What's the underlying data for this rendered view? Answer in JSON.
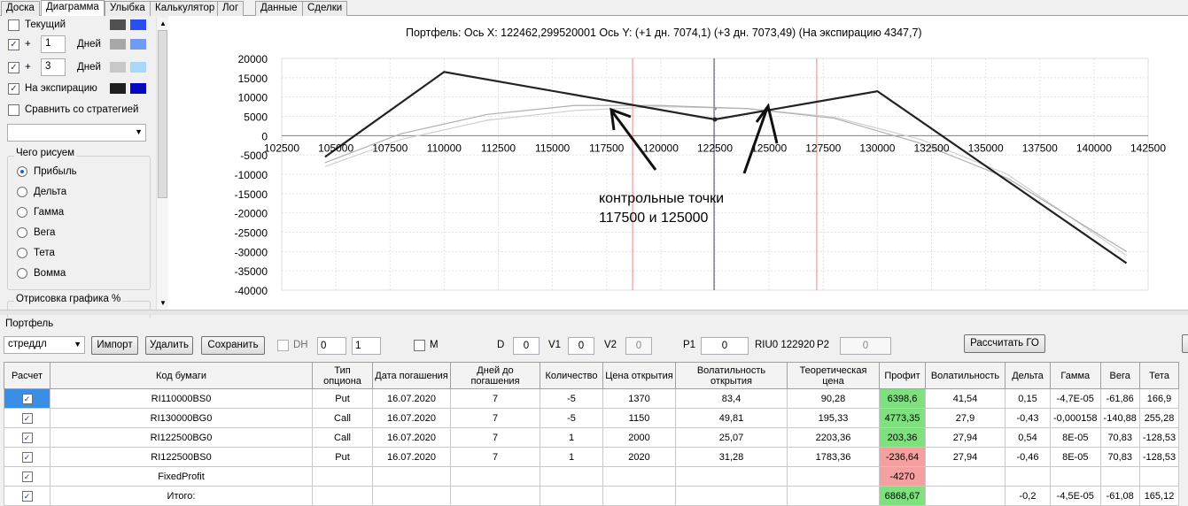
{
  "tabs": [
    "Доска",
    "Диаграмма",
    "Улыбка",
    "Калькулятор",
    "Лог",
    "Данные",
    "Сделки"
  ],
  "left": {
    "current_label": "Текущий",
    "plus1": "+",
    "days1_value": "1",
    "days_label1": "Дней",
    "plus2": "+",
    "days2_value": "3",
    "days_label2": "Дней",
    "expiration_label": "На экспирацию",
    "compare_label": "Сравнить со стратегией",
    "what_group": "Чего рисуем",
    "radios": [
      "Прибыль",
      "Дельта",
      "Гамма",
      "Вега",
      "Тета",
      "Вомма"
    ],
    "drawing_group": "Отрисовка графика %"
  },
  "chart_title": "Портфель: Ось X:  122462,299520001 Ось Y:   (+1 дн. 7074,1)   (+3 дн. 7073,49)   (На экспирацию 4347,7)",
  "annotation_line1": "контрольные точки",
  "annotation_line2": "117500 и 125000",
  "chart_data": {
    "type": "line",
    "xlim": [
      102500,
      142500
    ],
    "ylim": [
      -40000,
      20000
    ],
    "x_ticks": [
      "102500",
      "105000",
      "107500",
      "110000",
      "112500",
      "115000",
      "117500",
      "120000",
      "122500",
      "125000",
      "127500",
      "130000",
      "132500",
      "135000",
      "137500",
      "140000",
      "142500"
    ],
    "y_ticks": [
      "20000",
      "15000",
      "10000",
      "5000",
      "0",
      "-5000",
      "-10000",
      "-15000",
      "-20000",
      "-25000",
      "-30000",
      "-35000",
      "-40000"
    ],
    "series": [
      {
        "x": [
          104500,
          110000,
          122500,
          130000,
          141500
        ],
        "y": [
          -5500,
          16500,
          4200,
          11500,
          -33000
        ]
      },
      {
        "x": [
          104500,
          108000,
          112000,
          116000,
          120000,
          124000,
          128000,
          132000,
          136000,
          141500
        ],
        "y": [
          -7000,
          500,
          5500,
          7800,
          7800,
          7000,
          4500,
          -2000,
          -11000,
          -30000
        ]
      },
      {
        "x": [
          104500,
          108000,
          112000,
          116000,
          120000,
          124000,
          128000,
          132000,
          136000,
          141500
        ],
        "y": [
          -8000,
          -1000,
          4000,
          6500,
          7500,
          7000,
          4800,
          -1000,
          -10000,
          -31000
        ]
      }
    ],
    "vlines": [
      {
        "x": 118700,
        "color": "#f2a0a0"
      },
      {
        "x": 122462,
        "color": "#6a6a90"
      },
      {
        "x": 127200,
        "color": "#f2a0a0"
      }
    ],
    "grid": true
  },
  "portfolio": {
    "title": "Портфель",
    "strategy": "стреддл",
    "import": "Импорт",
    "delete": "Удалить",
    "save": "Сохранить",
    "dh": "DH",
    "num1": "0",
    "num2": "1",
    "m": "M",
    "d_label": "D",
    "d_value": "0",
    "v1_label": "V1",
    "v1_value": "0",
    "v2_label": "V2",
    "v2_value": "0",
    "p1_label": "P1",
    "p1_value": "0",
    "riu": "RIU0 122920",
    "p2_label": "P2",
    "p2_value": "0",
    "calc": "Рассчитать ГО"
  },
  "table": {
    "headers": [
      "Расчет",
      "Код бумаги",
      "Тип опциона",
      "Дата погашения",
      "Дней до погашения",
      "Количество",
      "Цена открытия",
      "Волатильность открытия",
      "Теоретическая цена",
      "Профит",
      "Волатильность",
      "Дельта",
      "Гамма",
      "Вега",
      "Тета"
    ],
    "rows": [
      [
        "RI110000BS0",
        "Put",
        "16.07.2020",
        "7",
        "-5",
        "1370",
        "83,4",
        "90,28",
        "6398,6",
        "41,54",
        "0,15",
        "-4,7E-05",
        "-61,86",
        "166,9"
      ],
      [
        "RI130000BG0",
        "Call",
        "16.07.2020",
        "7",
        "-5",
        "1150",
        "49,81",
        "195,33",
        "4773,35",
        "27,9",
        "-0,43",
        "-0,000158",
        "-140,88",
        "255,28"
      ],
      [
        "RI122500BG0",
        "Call",
        "16.07.2020",
        "7",
        "1",
        "2000",
        "25,07",
        "2203,36",
        "203,36",
        "27,94",
        "0,54",
        "8E-05",
        "70,83",
        "-128,53"
      ],
      [
        "RI122500BS0",
        "Put",
        "16.07.2020",
        "7",
        "1",
        "2020",
        "31,28",
        "1783,36",
        "-236,64",
        "27,94",
        "-0,46",
        "8E-05",
        "70,83",
        "-128,53"
      ],
      [
        "FixedProfit",
        "",
        "",
        "",
        "",
        "",
        "",
        "",
        "-4270",
        "",
        "",
        "",
        "",
        ""
      ],
      [
        "Итого:",
        "",
        "",
        "",
        "",
        "",
        "",
        "",
        "6868,67",
        "",
        "-0,2",
        "-4,5E-05",
        "-61,08",
        "165,12"
      ]
    ]
  }
}
